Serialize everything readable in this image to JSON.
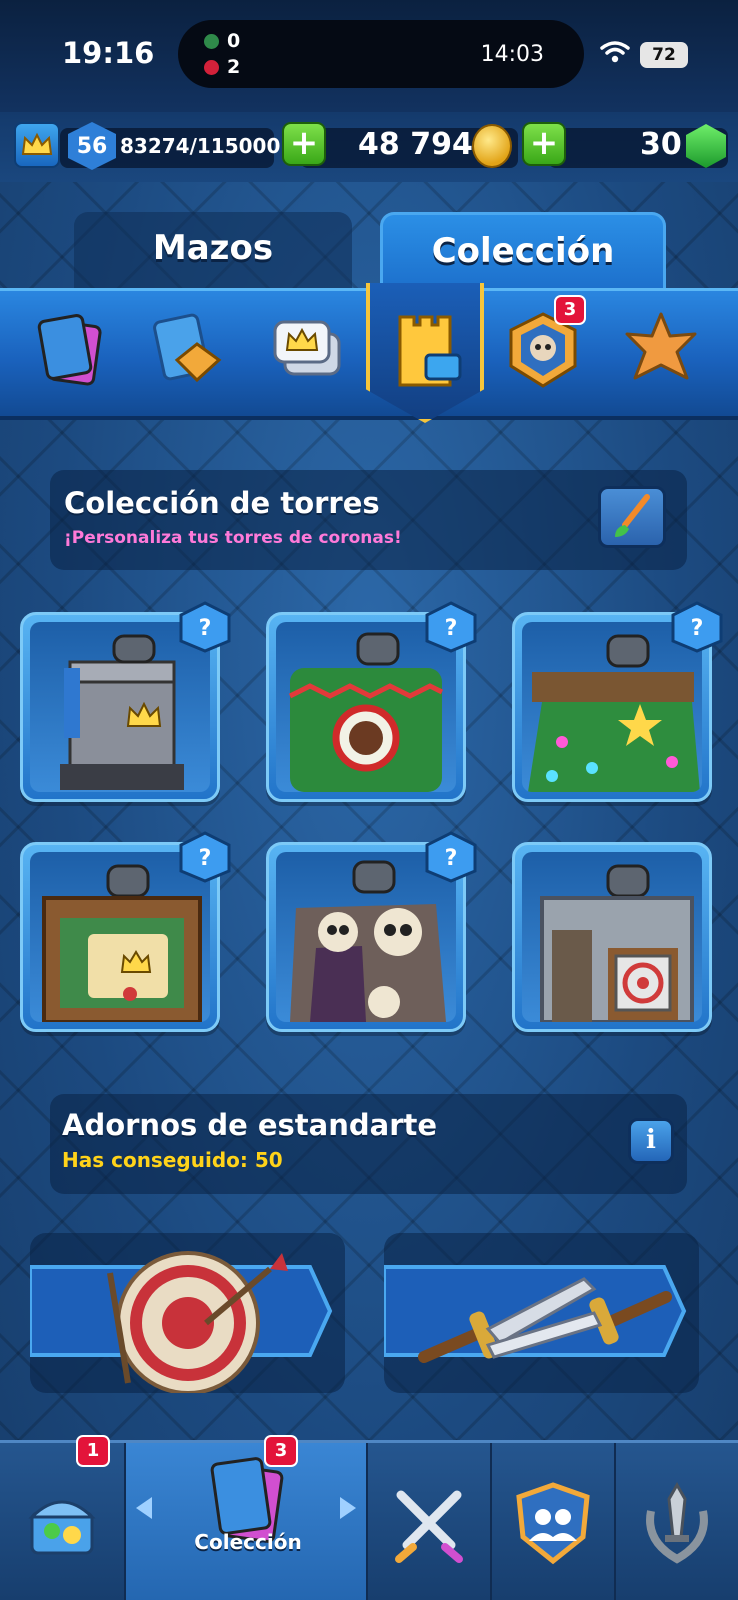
{
  "status_bar": {
    "time": "19:16",
    "score_top": "0",
    "score_bottom": "2",
    "match_time": "14:03",
    "battery": "72"
  },
  "resources": {
    "level": "56",
    "xp": "83274/115000",
    "gold": "48 794",
    "gems": "30"
  },
  "tabs": [
    {
      "label": "Mazos",
      "active": false
    },
    {
      "label": "Colección",
      "active": true
    }
  ],
  "categories": [
    {
      "icon": "cards-icon"
    },
    {
      "icon": "card-upgrade-icon"
    },
    {
      "icon": "emote-icon"
    },
    {
      "icon": "tower-icon",
      "selected": true
    },
    {
      "icon": "banner-badge-icon",
      "badge": "3"
    },
    {
      "icon": "star-level-icon"
    }
  ],
  "tower_section": {
    "title": "Colección de torres",
    "subtitle": "¡Personaliza tus torres de coronas!"
  },
  "towers": [
    {
      "name": "classic-tower"
    },
    {
      "name": "ugly-sweater-tower"
    },
    {
      "name": "christmas-tree-tower"
    },
    {
      "name": "treasure-map-tower"
    },
    {
      "name": "skull-coffin-tower"
    },
    {
      "name": "target-practice-tower"
    }
  ],
  "banner_section": {
    "title": "Adornos de estandarte",
    "subtitle": "Has conseguido: 50"
  },
  "bottom_nav": {
    "chest_badge": "1",
    "collection_badge": "3",
    "active_label": "Colección"
  },
  "colors": {
    "accent_gold": "#f5c53b",
    "subtitle_pink": "#ff7ad9",
    "subtitle_yellow": "#ffd31a",
    "badge_red": "#e3143a"
  }
}
